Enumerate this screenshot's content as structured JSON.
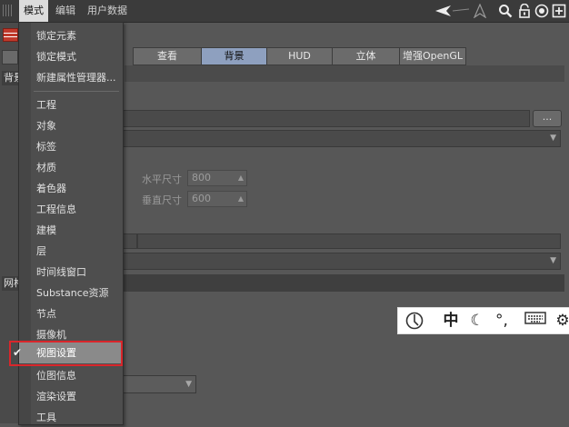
{
  "menubar": {
    "items": [
      {
        "label": "模式",
        "active": true
      },
      {
        "label": "编辑",
        "active": false
      },
      {
        "label": "用户数据",
        "active": false
      }
    ],
    "toolbar_icons": [
      "arrow-left-icon",
      "arrow-up-icon",
      "search-icon",
      "lock-icon",
      "target-icon",
      "new-window-icon"
    ]
  },
  "side_labels": {
    "top": "背景",
    "bottom": "网格"
  },
  "tabs": [
    {
      "label": "查看",
      "selected": false
    },
    {
      "label": "背景",
      "selected": true
    },
    {
      "label": "HUD",
      "selected": false
    },
    {
      "label": "立体",
      "selected": false
    },
    {
      "label": "增强OpenGL",
      "selected": false
    }
  ],
  "browse_button": "...",
  "size_fields": {
    "horizontal_label": "水平尺寸",
    "horizontal_value": "800",
    "vertical_label": "垂直尺寸",
    "vertical_value": "600"
  },
  "ime_bar": {
    "lang": "中"
  },
  "mode_menu": {
    "items": [
      {
        "label": "锁定元素"
      },
      {
        "label": "锁定模式"
      },
      {
        "label": "新建属性管理器..."
      },
      {
        "label": "工程"
      },
      {
        "label": "对象"
      },
      {
        "label": "标签"
      },
      {
        "label": "材质"
      },
      {
        "label": "着色器"
      },
      {
        "label": "工程信息"
      },
      {
        "label": "建模"
      },
      {
        "label": "层"
      },
      {
        "label": "时间线窗口"
      },
      {
        "label": "Substance资源"
      },
      {
        "label": "节点"
      },
      {
        "label": "摄像机"
      },
      {
        "label": "视图设置",
        "checked": true,
        "highlighted": true
      },
      {
        "label": "位图信息"
      },
      {
        "label": "渲染设置"
      },
      {
        "label": "工具"
      }
    ]
  },
  "colors": {
    "highlight_box": "#d9262b",
    "selected_tab": "#8ea0bf"
  }
}
